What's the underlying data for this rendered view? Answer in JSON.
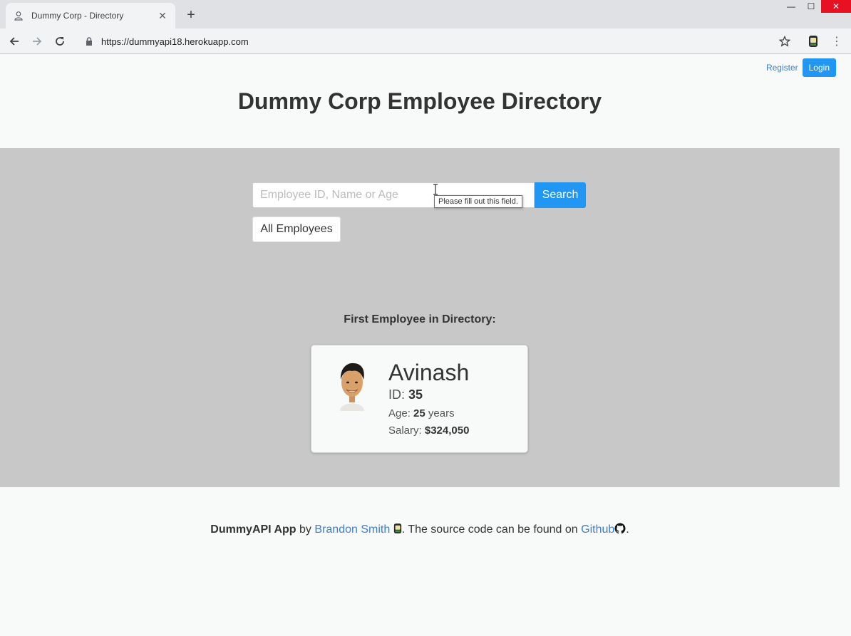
{
  "browser": {
    "tab_title": "Dummy Corp - Directory",
    "url": "https://dummyapi18.herokuapp.com",
    "close_glyph": "✕",
    "new_tab_glyph": "+",
    "menu_glyph": "⋮",
    "win_min": "—",
    "win_max": "☐",
    "win_close": "✕"
  },
  "header": {
    "register_label": "Register",
    "login_label": "Login",
    "title": "Dummy Corp Employee Directory"
  },
  "search": {
    "placeholder": "Employee ID, Name or Age",
    "value": "",
    "button_label": "Search",
    "tooltip": "Please fill out this field.",
    "all_button_label": "All Employees"
  },
  "featured": {
    "heading": "First Employee in Directory:",
    "name": "Avinash",
    "id_label": "ID:",
    "id_value": "35",
    "age_label": "Age:",
    "age_value": "25",
    "age_unit": "years",
    "salary_label": "Salary:",
    "salary_value": "$324,050"
  },
  "footer": {
    "brand": "DummyAPI App",
    "by": "by",
    "author": "Brandon Smith",
    "middle": ". The source code can be found on",
    "repo_link": "Github",
    "end": "."
  },
  "colors": {
    "accent": "#2196f3",
    "link": "#3f7fc7",
    "band": "#c8c8c8",
    "window_close": "#e81123"
  },
  "icons": [
    "user-icon",
    "close-icon",
    "plus-icon",
    "back-icon",
    "forward-icon",
    "reload-icon",
    "lock-icon",
    "star-icon",
    "extension-icon",
    "menu-icon",
    "github-icon"
  ]
}
